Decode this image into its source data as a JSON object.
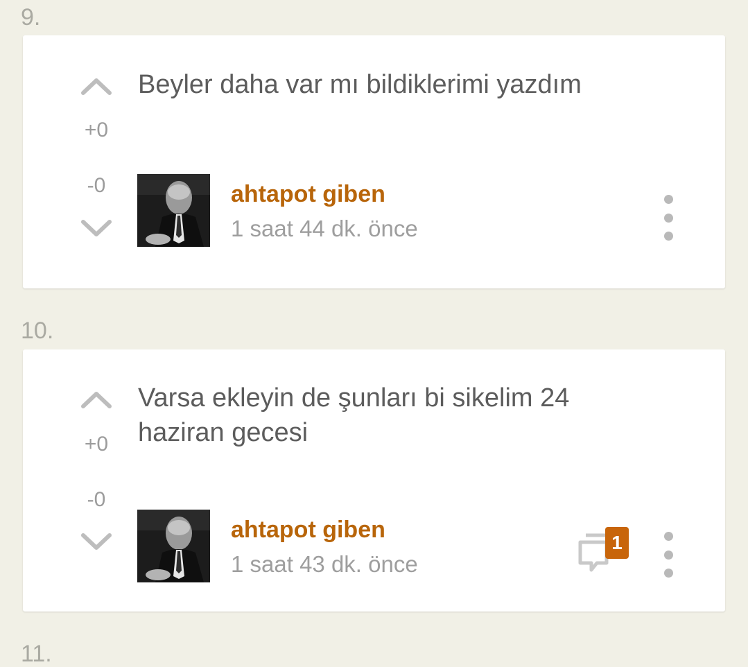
{
  "entries": [
    {
      "number": "9.",
      "text": "Beyler daha var mı bildiklerimi yazdım",
      "upvotes": "+0",
      "downvotes": "-0",
      "author": "ahtapot giben",
      "time": "1 saat 44 dk. önce"
    },
    {
      "number": "10.",
      "text": "Varsa ekleyin de şunları bi sikelim 24 haziran gecesi",
      "upvotes": "+0",
      "downvotes": "-0",
      "author": "ahtapot giben",
      "time": "1 saat 43 dk. önce",
      "comment_count": "1"
    },
    {
      "number": "11."
    }
  ],
  "icons": {
    "upvote": "chevron-up-icon",
    "downvote": "chevron-down-icon",
    "comment": "comment-bubble-icon",
    "more": "vertical-dots-icon"
  },
  "colors": {
    "background": "#f1f0e6",
    "card": "#ffffff",
    "author": "#b8650a",
    "badge": "#c8650a",
    "text": "#5c5c5c",
    "muted": "#9e9e9e"
  }
}
